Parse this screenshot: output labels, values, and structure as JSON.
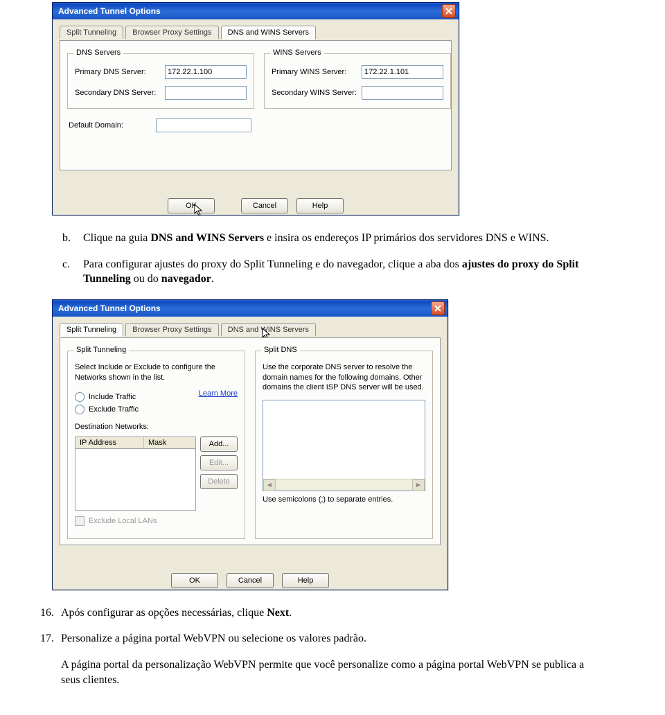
{
  "dialog1": {
    "title": "Advanced Tunnel Options",
    "tabs": [
      "Split Tunneling",
      "Browser Proxy Settings",
      "DNS and WINS Servers"
    ],
    "dns_legend": "DNS Servers",
    "wins_legend": "WINS Servers",
    "primary_dns_label": "Primary DNS Server:",
    "primary_dns_value": "172.22.1.100",
    "secondary_dns_label": "Secondary DNS Server:",
    "secondary_dns_value": "",
    "primary_wins_label": "Primary WINS Server:",
    "primary_wins_value": "172.22.1.101",
    "secondary_wins_label": "Secondary WINS Server:",
    "secondary_wins_value": "",
    "default_domain_label": "Default Domain:",
    "default_domain_value": "",
    "buttons": {
      "ok": "OK",
      "cancel": "Cancel",
      "help": "Help"
    }
  },
  "text": {
    "b_label": "b.",
    "b_pre": "Clique na guia ",
    "b_bold": "DNS and WINS Servers",
    "b_post": " e insira os endereços IP primários dos servidores DNS e WINS.",
    "c_label": "c.",
    "c_pre": "Para configurar ajustes do proxy do Split Tunneling e do navegador, clique a aba dos ",
    "c_bold1": "ajustes do proxy do Split Tunneling",
    "c_mid": " ou do ",
    "c_bold2": "navegador",
    "c_post": ".",
    "n16_label": "16.",
    "n16_pre": "Após configurar as opções necessárias, clique ",
    "n16_bold": "Next",
    "n16_post": ".",
    "n17_label": "17.",
    "n17_text": "Personalize a página portal WebVPN ou selecione os valores padrão.",
    "p_text": "A página portal da personalização WebVPN permite que você personalize como a página portal WebVPN se publica a seus clientes."
  },
  "dialog2": {
    "title": "Advanced Tunnel Options",
    "tabs": [
      "Split Tunneling",
      "Browser Proxy Settings",
      "DNS and WINS Servers"
    ],
    "st_legend": "Split Tunneling",
    "sd_legend": "Split DNS",
    "st_desc": "Select Include or Exclude to configure the Networks shown in the list.",
    "sd_desc": "Use the corporate DNS server to resolve the domain names for the following domains. Other domains the client ISP DNS server will be used.",
    "include": "Include Traffic",
    "exclude": "Exclude Traffic",
    "learn_more": "Learn More",
    "dest_label": "Destination Networks:",
    "col_ip": "IP Address",
    "col_mask": "Mask",
    "chk_label": "Exclude Local LANs",
    "add": "Add...",
    "edit": "Edit...",
    "delete": "Delete",
    "hint": "Use semicolons (;) to separate entries.",
    "buttons": {
      "ok": "OK",
      "cancel": "Cancel",
      "help": "Help"
    }
  }
}
